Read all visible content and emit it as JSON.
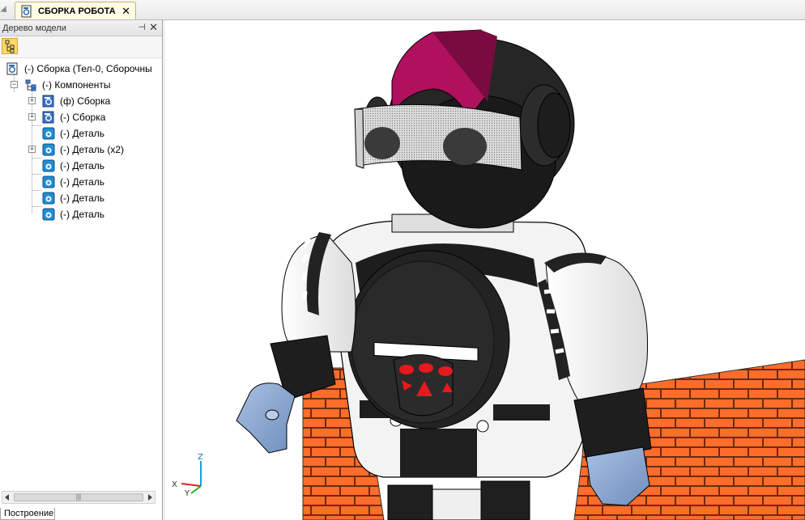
{
  "document_tab": {
    "title": "СБОРКА РОБОТА",
    "close": "✕",
    "icon": "assembly-file-icon"
  },
  "model_tree_panel": {
    "title": "Дерево модели",
    "pin": "⊣",
    "close": "✕",
    "bottom_tab": "Построение",
    "scroll_thumb": "|||",
    "nodes": [
      {
        "label": "(-) Сборка (Тел-0, Сборочны",
        "icon": "assembly-root-icon"
      },
      {
        "label": "(-) Компоненты",
        "icon": "components-folder-icon"
      },
      {
        "label": "(ф) Сборка",
        "icon": "subassembly-icon"
      },
      {
        "label": "(-) Сборка",
        "icon": "subassembly-icon"
      },
      {
        "label": "(-) Деталь",
        "icon": "part-icon"
      },
      {
        "label": "(-) Деталь (x2)",
        "icon": "part-icon"
      },
      {
        "label": "(-) Деталь",
        "icon": "part-icon"
      },
      {
        "label": "(-) Деталь",
        "icon": "part-icon"
      },
      {
        "label": "(-) Деталь",
        "icon": "part-icon"
      },
      {
        "label": "(-) Деталь",
        "icon": "part-icon"
      }
    ]
  },
  "viewport": {
    "axes": {
      "x": "X",
      "y": "Y",
      "z": "Z"
    },
    "colors": {
      "helmet_stripe": "#b0115e",
      "brick": "#ff6d2a",
      "body": "#2b2b2b",
      "hand": "#8ea9cf",
      "panel_button": "#e8191d"
    }
  }
}
